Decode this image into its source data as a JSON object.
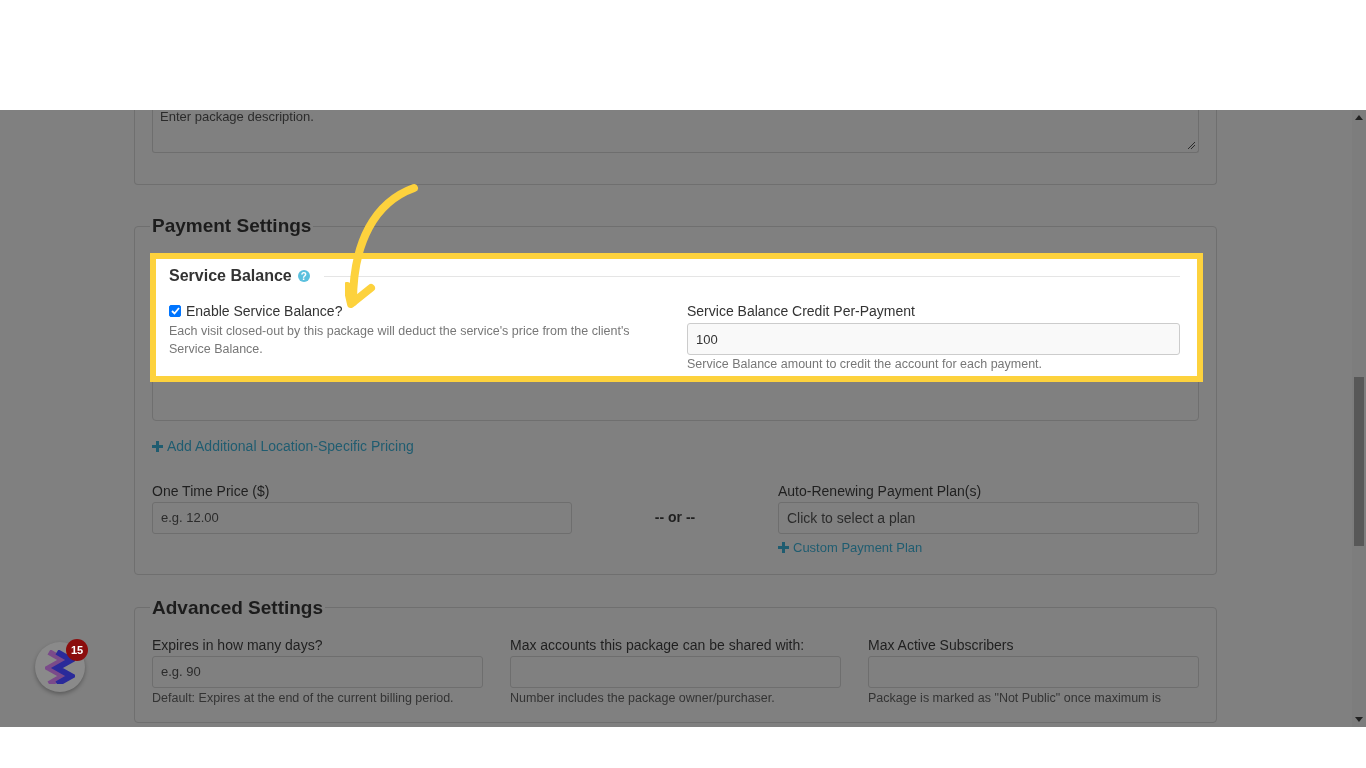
{
  "description": {
    "placeholder": "Enter package description."
  },
  "payment_settings": {
    "title": "Payment Settings",
    "service_balance": {
      "title": "Service Balance",
      "help_icon": "?",
      "enable": {
        "label": "Enable Service Balance?",
        "checked": true,
        "help": "Each visit closed-out by this package will deduct the service's price from the client's Service Balance."
      },
      "credit": {
        "label": "Service Balance Credit Per-Payment",
        "value": "100",
        "help": "Service Balance amount to credit the account for each payment."
      }
    },
    "add_pricing_link": "Add Additional Location-Specific Pricing",
    "one_time_price": {
      "label": "One Time Price ($)",
      "placeholder": "e.g. 12.00"
    },
    "separator": "-- or --",
    "payment_plan": {
      "label": "Auto-Renewing Payment Plan(s)",
      "placeholder": "Click to select a plan",
      "link": "Custom Payment Plan"
    }
  },
  "advanced_settings": {
    "title": "Advanced Settings",
    "fields": [
      {
        "label": "Expires in how many days?",
        "placeholder": "e.g. 90",
        "help": "Default: Expires at the end of the current billing period."
      },
      {
        "label": "Max accounts this package can be shared with:",
        "help": "Number includes the package owner/purchaser."
      },
      {
        "label": "Max Active Subscribers",
        "help": "Package is marked as \"Not Public\" once maximum is"
      }
    ]
  },
  "chat_widget": {
    "badge": "15"
  }
}
